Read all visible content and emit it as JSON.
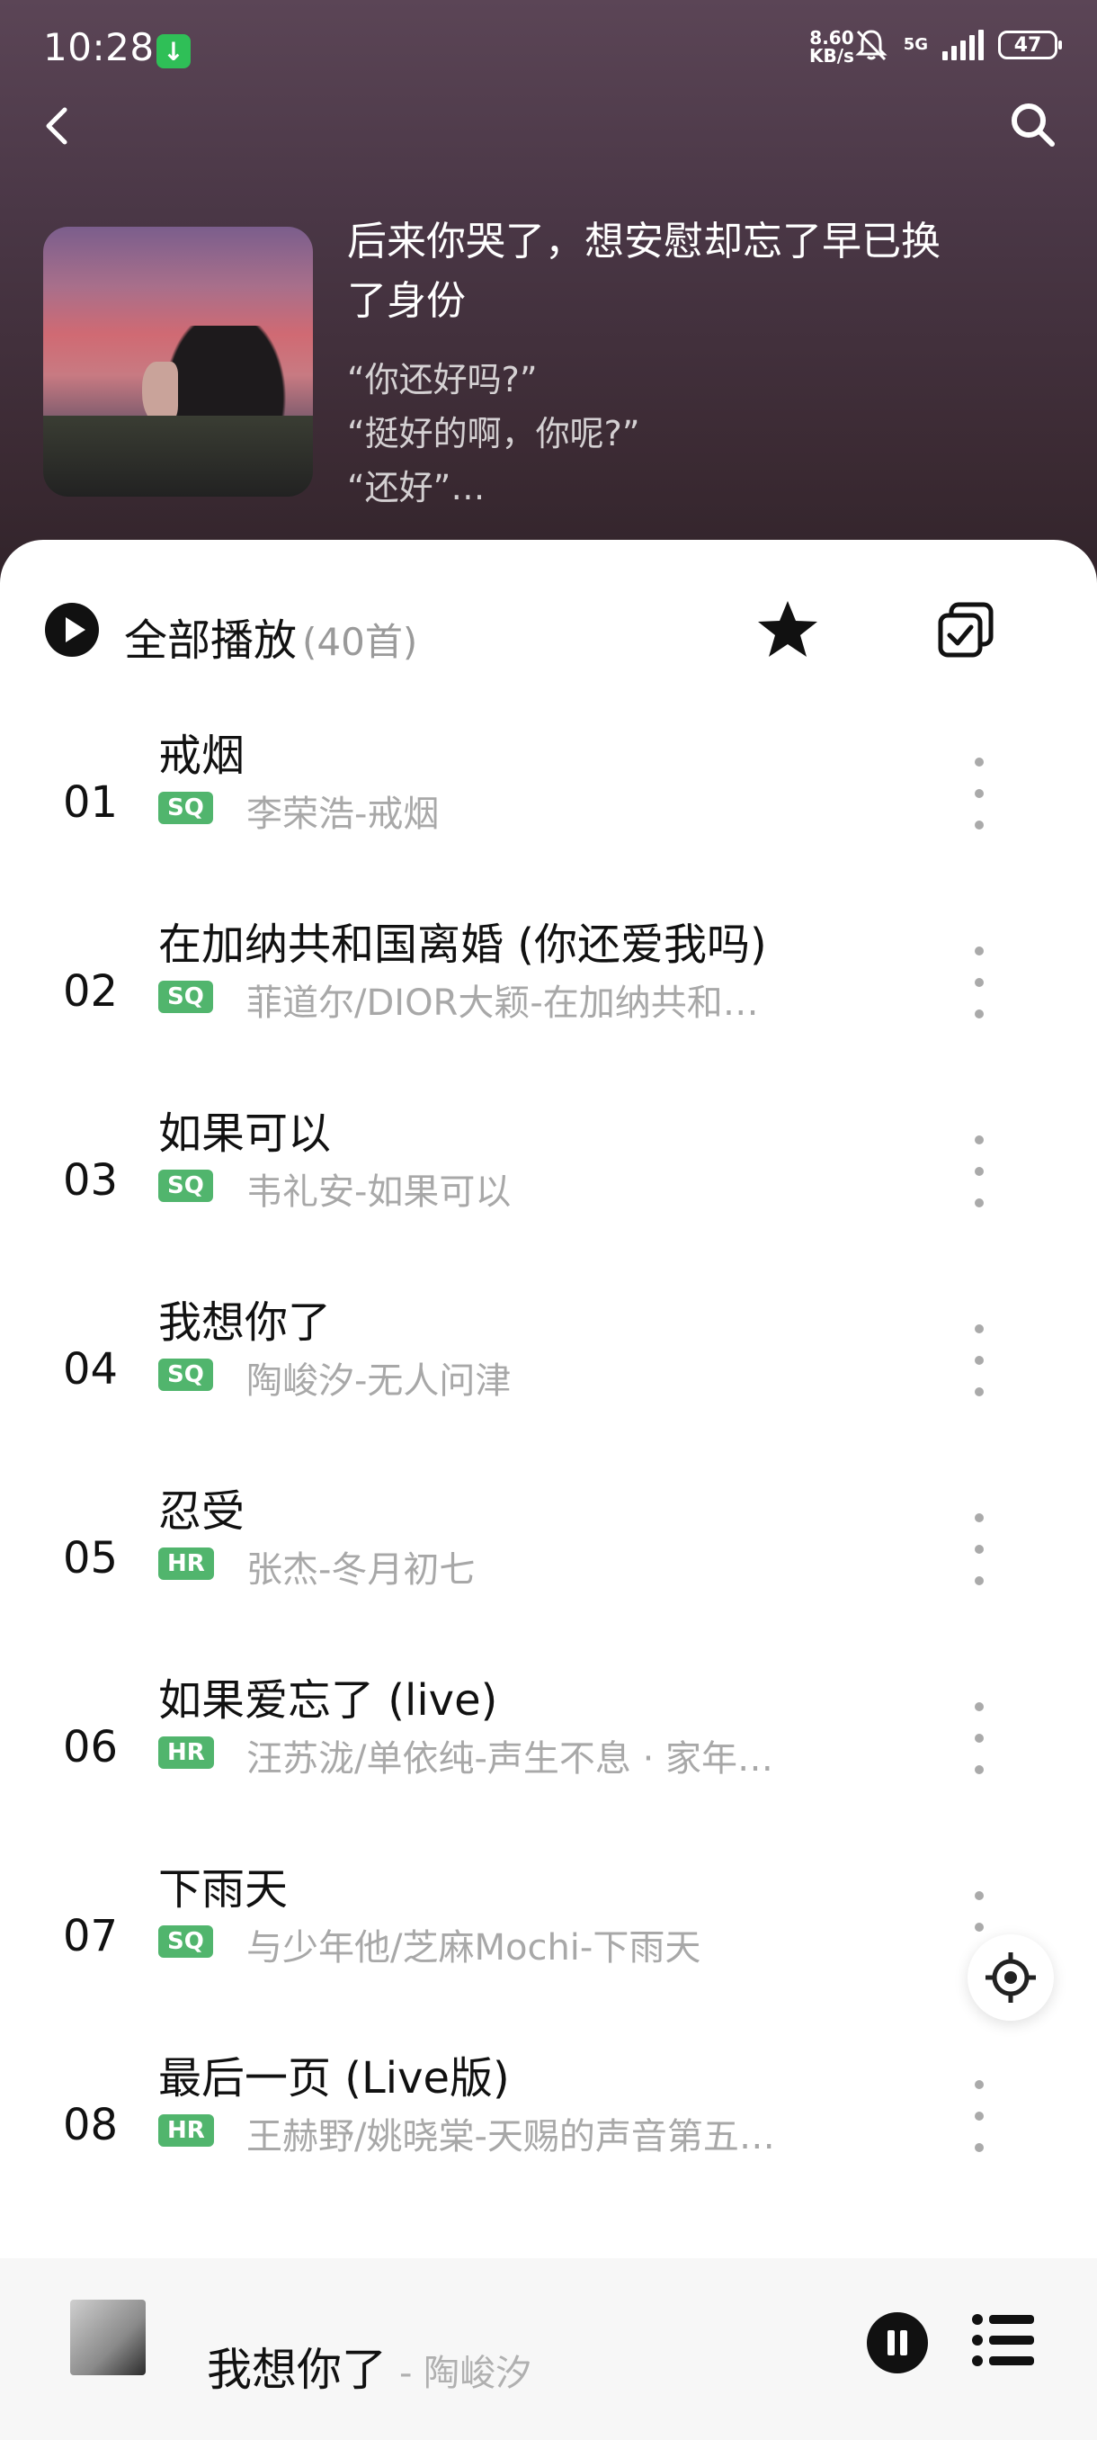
{
  "status_bar": {
    "time": "10:28",
    "net_speed_value": "8.60",
    "net_speed_unit": "KB/s",
    "network_label": "5G",
    "battery": "47"
  },
  "playlist": {
    "title": "后来你哭了，想安慰却忘了早已换了身份",
    "desc_lines": [
      "“你还好吗?”",
      "“挺好的啊，你呢?”",
      "“还好”…"
    ]
  },
  "toolbar": {
    "play_all_label": "全部播放",
    "count": "(40首)"
  },
  "songs": [
    {
      "num": "01",
      "title": "戒烟",
      "badge": "SQ",
      "sub": "李荣浩-戒烟"
    },
    {
      "num": "02",
      "title": "在加纳共和国离婚 (你还爱我吗)",
      "badge": "SQ",
      "sub": "菲道尔/DIOR大颖-在加纳共和…"
    },
    {
      "num": "03",
      "title": "如果可以",
      "badge": "SQ",
      "sub": "韦礼安-如果可以"
    },
    {
      "num": "04",
      "title": "我想你了",
      "badge": "SQ",
      "sub": "陶峻汐-无人问津"
    },
    {
      "num": "05",
      "title": "忍受",
      "badge": "HR",
      "sub": "张杰-冬月初七"
    },
    {
      "num": "06",
      "title": "如果爱忘了 (live)",
      "badge": "HR",
      "sub": "汪苏泷/单依纯-声生不息 · 家年…"
    },
    {
      "num": "07",
      "title": "下雨天",
      "badge": "SQ",
      "sub": "与少年他/芝麻Mochi-下雨天"
    },
    {
      "num": "08",
      "title": "最后一页 (Live版)",
      "badge": "HR",
      "sub": "王赫野/姚晓棠-天赐的声音第五…"
    }
  ],
  "now_playing": {
    "title": "我想你了",
    "artist": "- 陶峻汐"
  },
  "colors": {
    "badge_green": "#51b56d",
    "header_dark": "#3b2a33"
  }
}
